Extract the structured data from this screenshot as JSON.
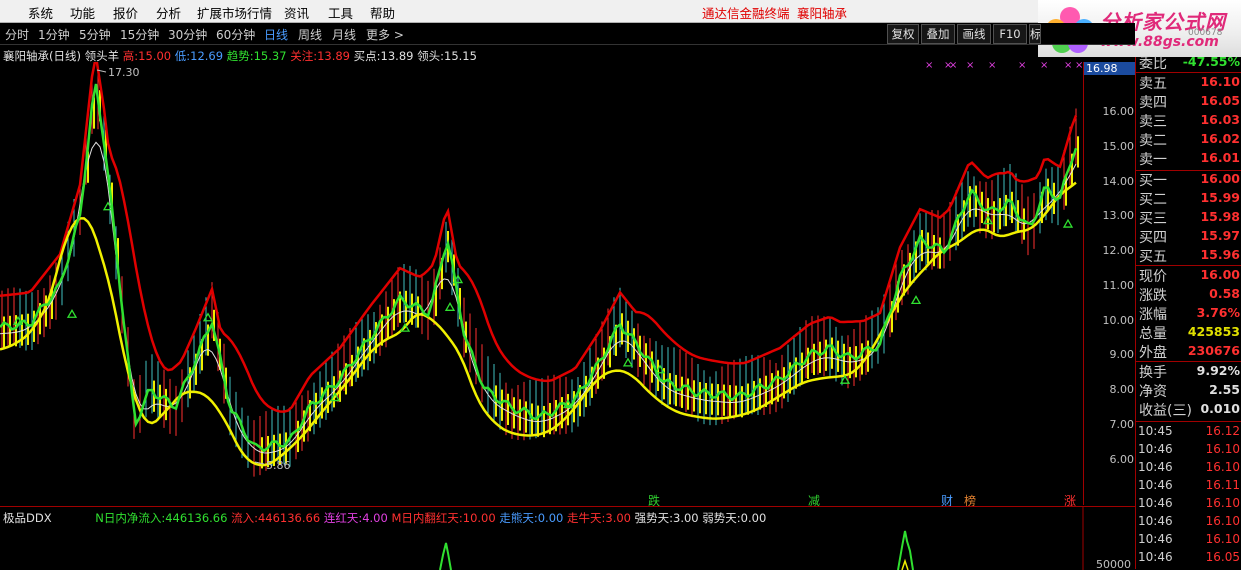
{
  "menu": {
    "items": [
      "系统",
      "功能",
      "报价",
      "分析",
      "扩展市场行情",
      "资讯",
      "工具",
      "帮助"
    ],
    "terminal": "通达信金融终端",
    "stock": "襄阳轴承"
  },
  "logo": {
    "title": "分析家公式网",
    "url": "www.88gs.com",
    "code": "000678"
  },
  "periods": {
    "items": [
      "分时",
      "1分钟",
      "5分钟",
      "15分钟",
      "30分钟",
      "60分钟",
      "日线",
      "周线",
      "月线",
      "更多 >"
    ],
    "active": "日线"
  },
  "toolbar": [
    "复权",
    "叠加",
    "画线",
    "F10",
    "标"
  ],
  "info": {
    "title": "襄阳轴承(日线)",
    "indicator": "领头羊",
    "high_label": "高:",
    "high": "15.00",
    "low_label": "低:",
    "low": "12.69",
    "trend_label": "趋势:",
    "trend": "15.37",
    "focus_label": "关注:",
    "focus": "13.89",
    "buy_label": "买点:",
    "buy": "13.89",
    "lead_label": "领头:",
    "lead": "15.15"
  },
  "price_axis": {
    "ticks": [
      "16.00",
      "15.00",
      "14.00",
      "13.00",
      "12.00",
      "11.00",
      "10.00",
      "9.00",
      "8.00",
      "7.00",
      "6.00"
    ],
    "current": "16.98"
  },
  "annotations": {
    "high": "17.30",
    "low": "5.86"
  },
  "events": [
    {
      "label": "跌",
      "color": "#30d030"
    },
    {
      "label": "减",
      "color": "#30d030"
    },
    {
      "label": "财",
      "color": "#4a9cff"
    },
    {
      "label": "榜",
      "color": "#e08030"
    },
    {
      "label": "涨",
      "color": "#ff3030"
    }
  ],
  "ddx": {
    "name": "极品DDX",
    "n_label": "N日内净流入:",
    "n_value": "446136.66",
    "in_label": "流入:",
    "in_value": "446136.66",
    "lh_label": "连红天:",
    "lh_value": "4.00",
    "m_label": "M日内翻红天:",
    "m_value": "10.00",
    "xn_label": "走熊天:",
    "xn_value": "0.00",
    "zn_label": "走牛天:",
    "zn_value": "3.00",
    "qs_label": "强势天:",
    "qs_value": "3.00",
    "rs_label": "弱势天:",
    "rs_value": "0.00",
    "axis_tick": "50000"
  },
  "quote": {
    "change_ratio": {
      "label": "委比",
      "value": "-47.55%"
    },
    "sells": [
      {
        "label": "卖五",
        "price": "16.10"
      },
      {
        "label": "卖四",
        "price": "16.05"
      },
      {
        "label": "卖三",
        "price": "16.03"
      },
      {
        "label": "卖二",
        "price": "16.02"
      },
      {
        "label": "卖一",
        "price": "16.01"
      }
    ],
    "buys": [
      {
        "label": "买一",
        "price": "16.00"
      },
      {
        "label": "买二",
        "price": "15.99"
      },
      {
        "label": "买三",
        "price": "15.98"
      },
      {
        "label": "买四",
        "price": "15.97"
      },
      {
        "label": "买五",
        "price": "15.96"
      }
    ],
    "stats": [
      {
        "label": "现价",
        "value": "16.00",
        "color": "#ff3030"
      },
      {
        "label": "涨跌",
        "value": "0.58",
        "color": "#ff3030"
      },
      {
        "label": "涨幅",
        "value": "3.76%",
        "color": "#ff3030"
      },
      {
        "label": "总量",
        "value": "425853",
        "color": "#e0e000"
      },
      {
        "label": "外盘",
        "value": "230676",
        "color": "#ff3030"
      }
    ],
    "stats2": [
      {
        "label": "换手",
        "value": "9.92%",
        "color": "#e0e0e0"
      },
      {
        "label": "净资",
        "value": "2.55",
        "color": "#e0e0e0"
      },
      {
        "label": "收益(三)",
        "value": "0.010",
        "color": "#e0e0e0"
      }
    ],
    "ticks": [
      {
        "time": "10:45",
        "price": "16.12"
      },
      {
        "time": "10:46",
        "price": "16.10"
      },
      {
        "time": "10:46",
        "price": "16.10"
      },
      {
        "time": "10:46",
        "price": "16.11"
      },
      {
        "time": "10:46",
        "price": "16.10"
      },
      {
        "time": "10:46",
        "price": "16.10"
      },
      {
        "time": "10:46",
        "price": "16.10"
      },
      {
        "time": "10:46",
        "price": "16.05"
      }
    ]
  },
  "colors": {
    "red": "#e00000",
    "green": "#30e030",
    "yellow": "#f0f000",
    "blue_accent": "#4a9cff",
    "magenta": "#e040e0"
  }
}
